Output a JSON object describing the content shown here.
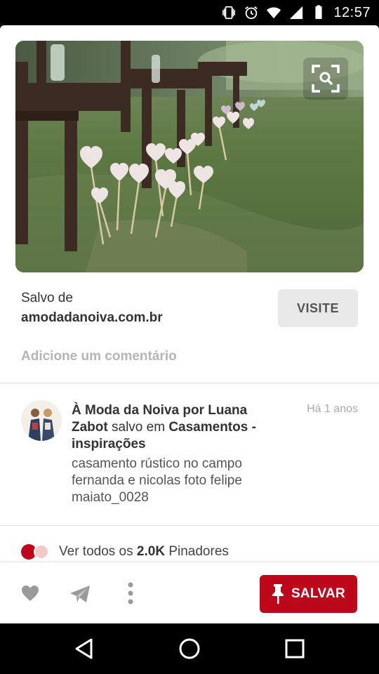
{
  "status_bar": {
    "time": "12:57",
    "icons": [
      "vibrate-icon",
      "alarm-icon",
      "wifi-icon",
      "signal-icon",
      "battery-icon"
    ]
  },
  "pin": {
    "image_icon": "visual-search-icon",
    "saved_from_label": "Salvo de",
    "saved_from_domain": "amodadanoiva.com.br",
    "visit_label": "VISITE",
    "comment_placeholder": "Adicione um comentário"
  },
  "attribution": {
    "author": "À Moda da Noiva por Luana Zabot",
    "saved_in_text": "salvo em",
    "board": "Casamentos - inspirações",
    "time_ago": "Há 1 anos",
    "description": "casamento rústico no campo fernanda e nicolas foto felipe maiato_0028"
  },
  "pinners": {
    "prefix": "Ver todos os",
    "count": "2.0K",
    "suffix": "Pinadores"
  },
  "actions": {
    "icons": [
      "heart-icon",
      "send-icon",
      "more-icon"
    ],
    "save_label": "SALVAR"
  },
  "colors": {
    "brand_red": "#bd081c",
    "muted_text": "#b5b5b5",
    "button_gray": "#e9e9e9"
  },
  "nav_bar": {
    "icons": [
      "back-icon",
      "home-icon",
      "recents-icon"
    ]
  }
}
